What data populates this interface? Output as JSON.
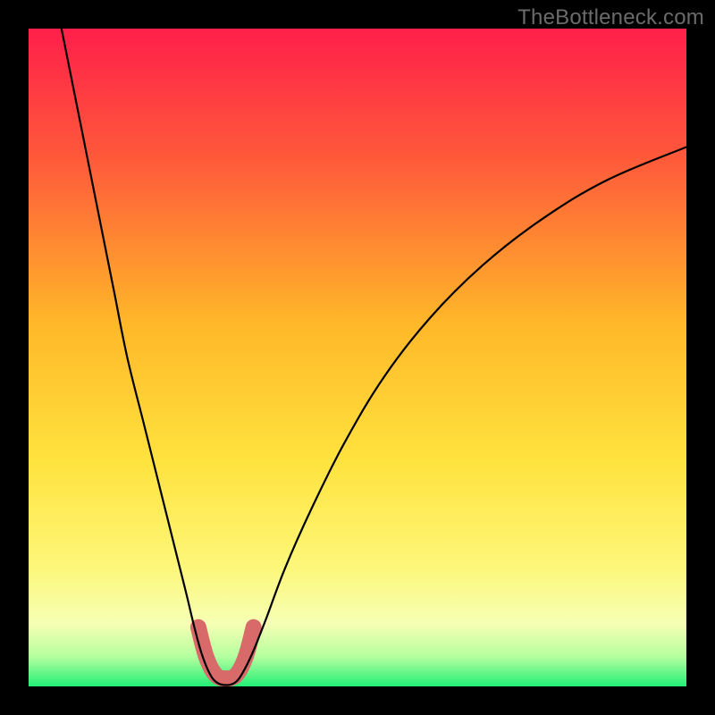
{
  "watermark": "TheBottleneck.com",
  "chart_data": {
    "type": "line",
    "title": "",
    "xlabel": "",
    "ylabel": "",
    "xlim": [
      0,
      100
    ],
    "ylim": [
      0,
      100
    ],
    "grid": false,
    "legend": false,
    "background_gradient": {
      "stops": [
        {
          "offset": 0.0,
          "color": "#ff1f4a"
        },
        {
          "offset": 0.2,
          "color": "#ff5a3a"
        },
        {
          "offset": 0.45,
          "color": "#ffb829"
        },
        {
          "offset": 0.66,
          "color": "#ffe33e"
        },
        {
          "offset": 0.82,
          "color": "#fdf77a"
        },
        {
          "offset": 0.905,
          "color": "#f6ffb4"
        },
        {
          "offset": 0.955,
          "color": "#b4ff9f"
        },
        {
          "offset": 1.0,
          "color": "#23ef75"
        }
      ]
    },
    "series": [
      {
        "name": "curve",
        "stroke": "#000000",
        "stroke_width": 2.2,
        "points": [
          {
            "x": 5.0,
            "y": 100.0
          },
          {
            "x": 7.0,
            "y": 90.0
          },
          {
            "x": 9.0,
            "y": 80.0
          },
          {
            "x": 11.0,
            "y": 70.0
          },
          {
            "x": 13.0,
            "y": 60.0
          },
          {
            "x": 15.0,
            "y": 50.0
          },
          {
            "x": 17.5,
            "y": 40.0
          },
          {
            "x": 20.0,
            "y": 30.0
          },
          {
            "x": 22.5,
            "y": 20.0
          },
          {
            "x": 24.0,
            "y": 14.0
          },
          {
            "x": 25.2,
            "y": 9.0
          },
          {
            "x": 26.3,
            "y": 5.0
          },
          {
            "x": 27.5,
            "y": 2.0
          },
          {
            "x": 28.6,
            "y": 0.6
          },
          {
            "x": 30.0,
            "y": 0.2
          },
          {
            "x": 31.4,
            "y": 0.6
          },
          {
            "x": 32.5,
            "y": 2.0
          },
          {
            "x": 34.0,
            "y": 5.0
          },
          {
            "x": 36.0,
            "y": 10.0
          },
          {
            "x": 39.0,
            "y": 18.0
          },
          {
            "x": 43.0,
            "y": 27.0
          },
          {
            "x": 48.0,
            "y": 37.0
          },
          {
            "x": 54.0,
            "y": 47.0
          },
          {
            "x": 61.0,
            "y": 56.0
          },
          {
            "x": 69.0,
            "y": 64.0
          },
          {
            "x": 78.0,
            "y": 71.0
          },
          {
            "x": 88.0,
            "y": 77.0
          },
          {
            "x": 100.0,
            "y": 82.0
          }
        ]
      },
      {
        "name": "highlight",
        "stroke": "#d86a6a",
        "stroke_width": 18,
        "linecap": "round",
        "points": [
          {
            "x": 25.8,
            "y": 9.0
          },
          {
            "x": 27.0,
            "y": 4.5
          },
          {
            "x": 28.4,
            "y": 1.8
          },
          {
            "x": 30.0,
            "y": 1.2
          },
          {
            "x": 31.6,
            "y": 1.8
          },
          {
            "x": 33.0,
            "y": 4.5
          },
          {
            "x": 34.2,
            "y": 9.0
          }
        ]
      }
    ]
  }
}
